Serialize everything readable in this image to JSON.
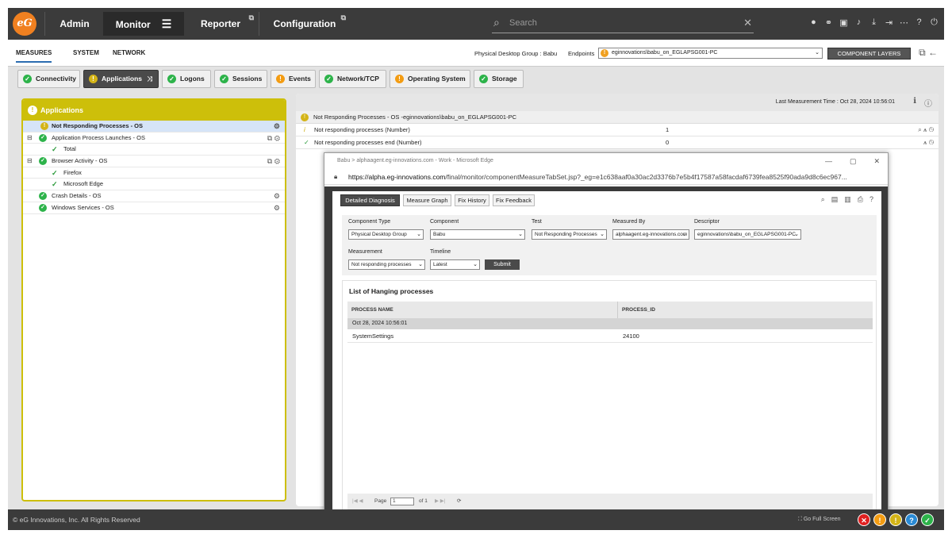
{
  "nav": {
    "logo_text": "eG",
    "tabs": [
      "Admin",
      "Monitor",
      "Reporter",
      "Configuration"
    ],
    "search_placeholder": "Search"
  },
  "subnav": {
    "tabs": [
      "MEASURES",
      "SYSTEM",
      "NETWORK"
    ],
    "physical_group": "Physical Desktop Group : Babu",
    "endpoints_label": "Endpoints",
    "endpoint_value": "eginnovations\\babu_on_EGLAPSG001-PC",
    "component_layers": "COMPONENT LAYERS"
  },
  "layers": [
    {
      "label": "Connectivity",
      "status": "green"
    },
    {
      "label": "Applications",
      "status": "yellow"
    },
    {
      "label": "Logons",
      "status": "green"
    },
    {
      "label": "Sessions",
      "status": "green"
    },
    {
      "label": "Events",
      "status": "orange"
    },
    {
      "label": "Network/TCP",
      "status": "green"
    },
    {
      "label": "Operating System",
      "status": "orange"
    },
    {
      "label": "Storage",
      "status": "green"
    }
  ],
  "tree": {
    "title": "Applications",
    "items": [
      "Not Responding Processes - OS",
      "Application Process Launches - OS",
      "Total",
      "Browser Activity - OS",
      "Firefox",
      "Microsoft Edge",
      "Crash Details - OS",
      "Windows Services - OS"
    ]
  },
  "measures": {
    "last_time": "Last Measurement Time : Oct 28, 2024 10:56:01",
    "header": "Not Responding Processes - OS -eginnovations\\babu_on_EGLAPSG001-PC",
    "rows": [
      {
        "label": "Not responding processes (Number)",
        "value": "1"
      },
      {
        "label": "Not responding processes end (Number)",
        "value": "0"
      }
    ]
  },
  "popup": {
    "title": "Babu > alphaagent.eg-innovations.com - Work - Microsoft Edge",
    "url_prefix": "https://alpha.eg-innovations.com",
    "url_rest": "/final/monitor/componentMeasureTabSet.jsp?_eg=e1c638aaf0a30ac2d3376b7e5b4f17587a58facdaf6739fea8525f90ada9d8c6ec967...",
    "tabs": [
      "Detailed Diagnosis",
      "Measure Graph",
      "Fix History",
      "Fix Feedback"
    ],
    "labels": {
      "component_type": "Component Type",
      "component": "Component",
      "test": "Test",
      "measured_by": "Measured By",
      "descriptor": "Descriptor",
      "measurement": "Measurement",
      "timeline": "Timeline"
    },
    "values": {
      "component_type": "Physical Desktop Group",
      "component": "Babu",
      "test": "Not Responding Processes",
      "measured_by": "alphaagent.eg-innovations.com",
      "descriptor": "eginnovations\\babu_on_EGLAPSG001-PC",
      "measurement": "Not responding processes",
      "timeline": "Latest"
    },
    "submit": "Submit",
    "list_title": "List of Hanging processes",
    "col_name": "PROCESS NAME",
    "col_id": "PROCESS_ID",
    "group": "Oct 28, 2024 10:56:01",
    "row_name": "SystemSettings",
    "row_id": "24100",
    "page_label": "Page",
    "page_value": "1",
    "page_of": "of 1"
  },
  "footer": {
    "copyright": "© eG Innovations, Inc. All Rights Reserved",
    "fullscreen": "Go Full Screen"
  },
  "colors": {
    "green": "#2db34a",
    "orange": "#f39c12",
    "yellow": "#d4b417",
    "accent_yellow": "#cdbf0a"
  }
}
